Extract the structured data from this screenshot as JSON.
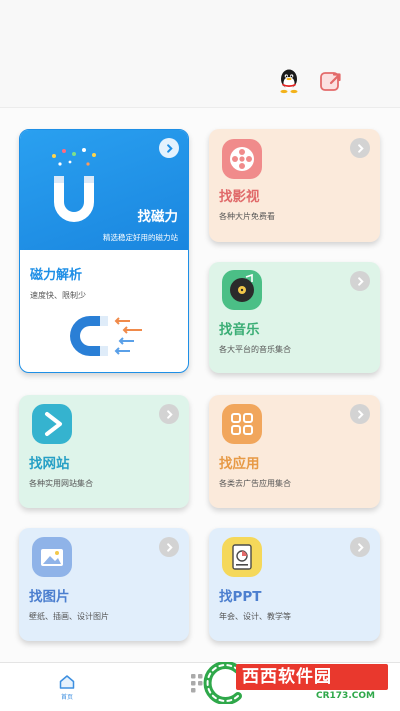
{
  "header": {
    "icons": [
      "qq-icon",
      "share-icon"
    ]
  },
  "magnet_card": {
    "title": "找磁力",
    "subtitle": "精选稳定好用的磁力站",
    "section_title": "磁力解析",
    "section_desc": "速度快、限制少",
    "color": "#1e8fe6"
  },
  "cards": [
    {
      "title": "找影视",
      "desc": "各种大片免费看",
      "title_color": "#e06a6a"
    },
    {
      "title": "找音乐",
      "desc": "各大平台的音乐集合",
      "title_color": "#3cae76"
    },
    {
      "title": "找网站",
      "desc": "各种实用网站集合",
      "title_color": "#27a0c6"
    },
    {
      "title": "找应用",
      "desc": "各类去广告应用集合",
      "title_color": "#e79a46"
    },
    {
      "title": "找图片",
      "desc": "壁纸、插画、设计图片",
      "title_color": "#4c7fcf"
    },
    {
      "title": "找PPT",
      "desc": "年会、设计、教学等",
      "title_color": "#4c7fcf"
    }
  ],
  "bottom_nav": {
    "home_label": "首页"
  },
  "watermark": {
    "text": "西西软件园",
    "url": "CR173.COM"
  }
}
